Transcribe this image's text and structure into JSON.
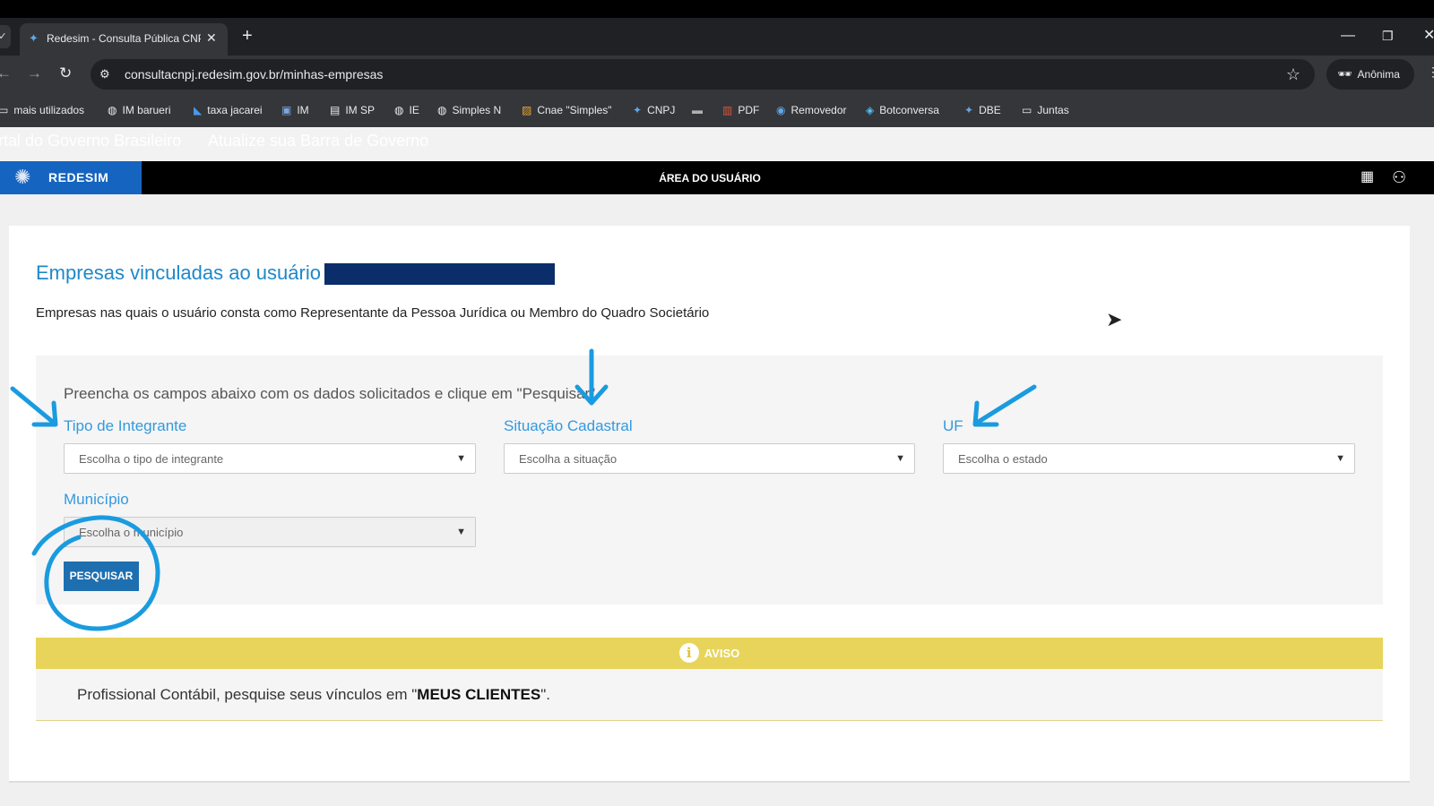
{
  "browser": {
    "tab_prev": "✓",
    "tab_title": "Redesim - Consulta Pública CNPJ",
    "tab_close": "✕",
    "new_tab": "+",
    "window_controls": {
      "minimize": "—",
      "restore": "❐",
      "close": "✕"
    },
    "url": "consultacnpj.redesim.gov.br/minhas-empresas",
    "profile": "Anônima",
    "bookmarks": [
      {
        "label": "mais utilizados",
        "icon": "folder-icon"
      },
      {
        "label": "IM barueri",
        "icon": "globe-icon"
      },
      {
        "label": "taxa jacarei",
        "icon": "site-icon"
      },
      {
        "label": "IM",
        "icon": "site-icon"
      },
      {
        "label": "IM SP",
        "icon": "page-icon"
      },
      {
        "label": "IE",
        "icon": "globe-icon"
      },
      {
        "label": "Simples N",
        "icon": "globe-icon"
      },
      {
        "label": "Cnae \"Simples\"",
        "icon": "site-icon"
      },
      {
        "label": "CNPJ",
        "icon": "site-icon"
      },
      {
        "label": "",
        "icon": "site-icon"
      },
      {
        "label": "PDF",
        "icon": "site-icon"
      },
      {
        "label": "Removedor",
        "icon": "site-icon"
      },
      {
        "label": "Botconversa",
        "icon": "site-icon"
      },
      {
        "label": "DBE",
        "icon": "site-icon"
      },
      {
        "label": "Juntas",
        "icon": "folder-icon"
      }
    ]
  },
  "gov_bar": {
    "portal_link": "rtal do Governo Brasileiro",
    "update_link": "Atualize sua Barra de Governo"
  },
  "header": {
    "logo_text": "REDESIM",
    "title": "ÁREA DO USUÁRIO"
  },
  "main": {
    "title": "Empresas vinculadas ao usuário -",
    "description": "Empresas nas quais o usuário consta como Representante da Pessoa Jurídica ou Membro do Quadro Societário",
    "instructions": "Preencha os campos abaixo com os dados solicitados e clique em \"Pesquisar\"",
    "fields": {
      "tipo": {
        "label": "Tipo de Integrante",
        "placeholder": "Escolha o tipo de integrante"
      },
      "situacao": {
        "label": "Situação Cadastral",
        "placeholder": "Escolha a situação"
      },
      "uf": {
        "label": "UF",
        "placeholder": "Escolha o estado"
      },
      "municipio": {
        "label": "Município",
        "placeholder": "Escolha o município"
      }
    },
    "search_button": "PESQUISAR"
  },
  "notice": {
    "label": "AVISO",
    "text_prefix": "Profissional Contábil, pesquise seus vínculos em \"",
    "text_strong": "MEUS CLIENTES",
    "text_suffix": "\"."
  },
  "colors": {
    "accent": "#1e88c9",
    "header_bg": "#000000",
    "logo_bg": "#1565c0",
    "notice_bg": "#e8d45a",
    "annotation": "#1a9be0",
    "redaction": "#0b2e6b"
  }
}
